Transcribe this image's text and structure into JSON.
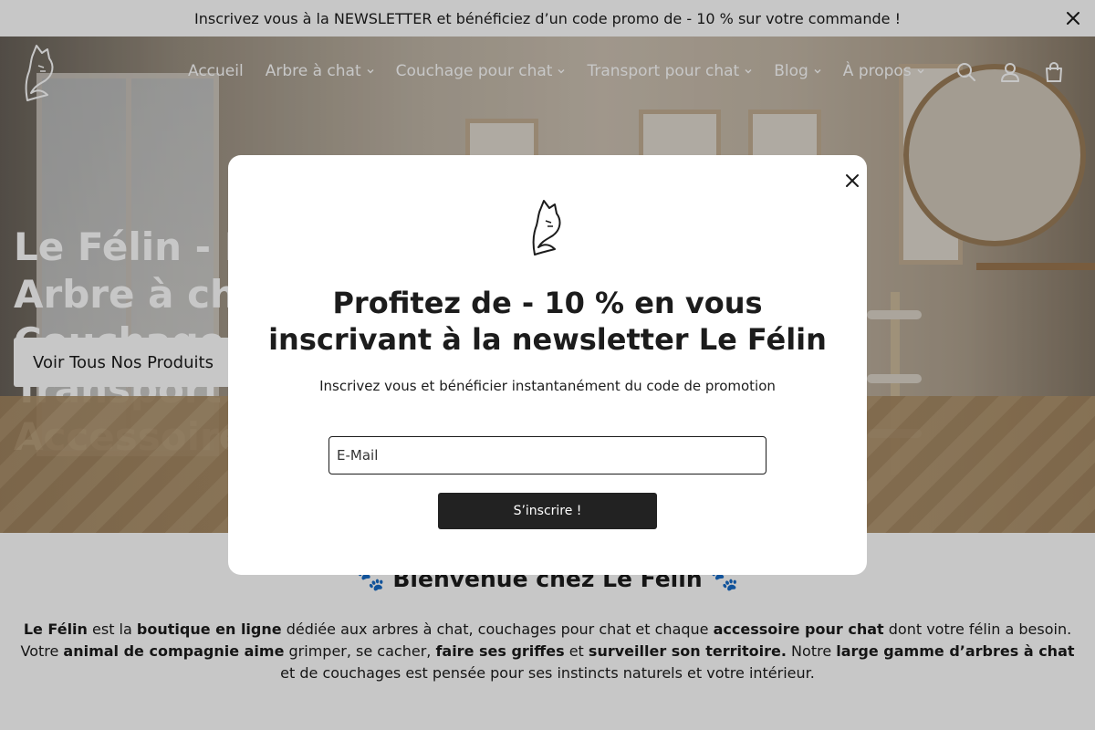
{
  "announcement": {
    "text": "Inscrivez vous à la NEWSLETTER et bénéficiez d’un code promo de - 10 % sur votre commande !",
    "close_icon": "close-icon"
  },
  "header": {
    "nav": [
      {
        "label": "Accueil",
        "dropdown": false
      },
      {
        "label": "Arbre à chat",
        "dropdown": true
      },
      {
        "label": "Couchage pour chat",
        "dropdown": true
      },
      {
        "label": "Transport pour chat",
        "dropdown": true
      },
      {
        "label": "Blog",
        "dropdown": true
      },
      {
        "label": "À propos",
        "dropdown": true
      }
    ],
    "icons": [
      "search-icon",
      "account-icon",
      "cart-icon"
    ]
  },
  "hero": {
    "title": "Le Félin - Boutique Arbre à chat, Couchage, Transport & Accessoires",
    "cta_label": "Voir Tous Nos Produits"
  },
  "welcome": {
    "title": "🐾 Bienvenue chez Le Félin 🐾",
    "line1": {
      "t1": "Le Félin",
      "t2": " est la ",
      "t3": "boutique en ligne",
      "t4": " dédiée aux arbres à chat, couchages pour chat et chaque ",
      "t5": "accessoire pour chat",
      "t6": " dont votre félin a besoin."
    },
    "line2": {
      "t1": "Votre ",
      "t2": "animal de compagnie aime",
      "t3": " grimper, se cacher, ",
      "t4": "faire ses griffes",
      "t5": " et ",
      "t6": "surveiller son territoire.",
      "t7": " Notre ",
      "t8": "large gamme d’arbres à chat",
      "t9": " et de couchages est pensée pour ses instincts naturels et votre intérieur."
    }
  },
  "modal": {
    "title": "Profitez de - 10 % en vous inscrivant à la newsletter Le Félin",
    "subtitle": "Inscrivez vous et bénéficier instantanément du code de promotion",
    "email_placeholder": "E-Mail",
    "email_value": "",
    "submit_label": "S’inscrire !"
  },
  "colors": {
    "button_dark": "#222222",
    "overlay": "rgba(0,0,0,0.22)",
    "text": "#1c1c1c"
  }
}
